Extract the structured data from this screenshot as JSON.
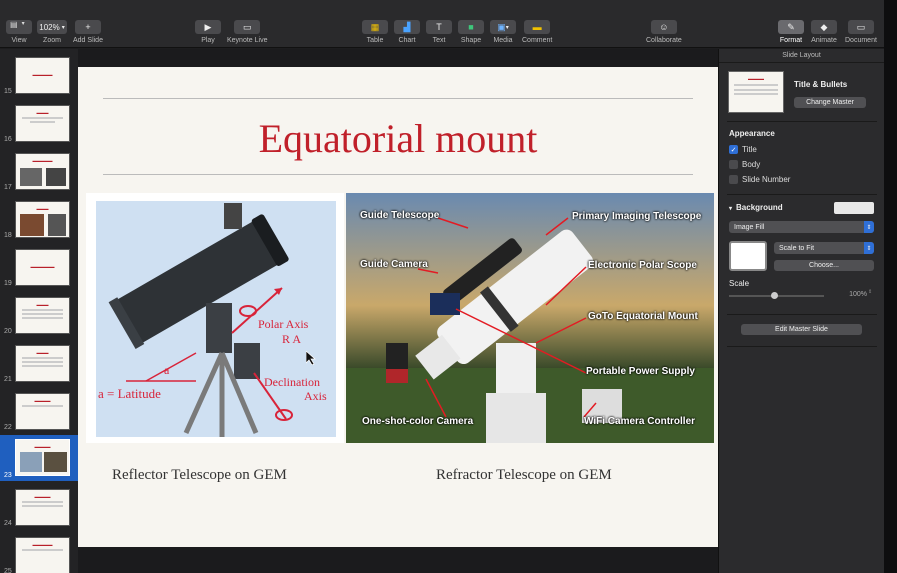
{
  "toolbar": {
    "view": "View",
    "zoom_value": "102%",
    "zoom": "Zoom",
    "add_slide": "Add Slide",
    "play": "Play",
    "keynote_live": "Keynote Live",
    "table": "Table",
    "chart": "Chart",
    "text": "Text",
    "shape": "Shape",
    "media": "Media",
    "comment": "Comment",
    "collaborate": "Collaborate",
    "format": "Format",
    "animate": "Animate",
    "document": "Document"
  },
  "navigator": {
    "slides": [
      {
        "num": "15"
      },
      {
        "num": "16"
      },
      {
        "num": "17"
      },
      {
        "num": "18"
      },
      {
        "num": "19"
      },
      {
        "num": "20"
      },
      {
        "num": "21"
      },
      {
        "num": "22"
      },
      {
        "num": "23"
      },
      {
        "num": "24"
      },
      {
        "num": "25"
      }
    ],
    "selected": "23"
  },
  "slide": {
    "title": "Equatorial mount",
    "left_caption": "Reflector Telescope on GEM",
    "right_caption": "Refractor Telescope on GEM",
    "left_labels": {
      "polar_axis": "Polar Axis",
      "ra": "R A",
      "a": "a",
      "latitude": "a = Latitude",
      "declination": "Declination",
      "axis": "Axis"
    },
    "right_labels": {
      "guide_telescope": "Guide Telescope",
      "primary": "Primary Imaging Telescope",
      "guide_camera": "Guide Camera",
      "polar_scope": "Electronic Polar Scope",
      "goto": "GoTo Equatorial Mount",
      "power": "Portable Power Supply",
      "osc": "One-shot-color Camera",
      "wifi": "WiFi Camera Controller"
    }
  },
  "inspector": {
    "header": "Slide Layout",
    "layout_name": "Title & Bullets",
    "change_master": "Change Master",
    "appearance": "Appearance",
    "title": "Title",
    "body": "Body",
    "slide_number": "Slide Number",
    "background": "Background",
    "fill_type": "Image Fill",
    "scale_mode": "Scale to Fit",
    "choose": "Choose...",
    "scale": "Scale",
    "scale_value": "100%",
    "edit_master": "Edit Master Slide"
  }
}
